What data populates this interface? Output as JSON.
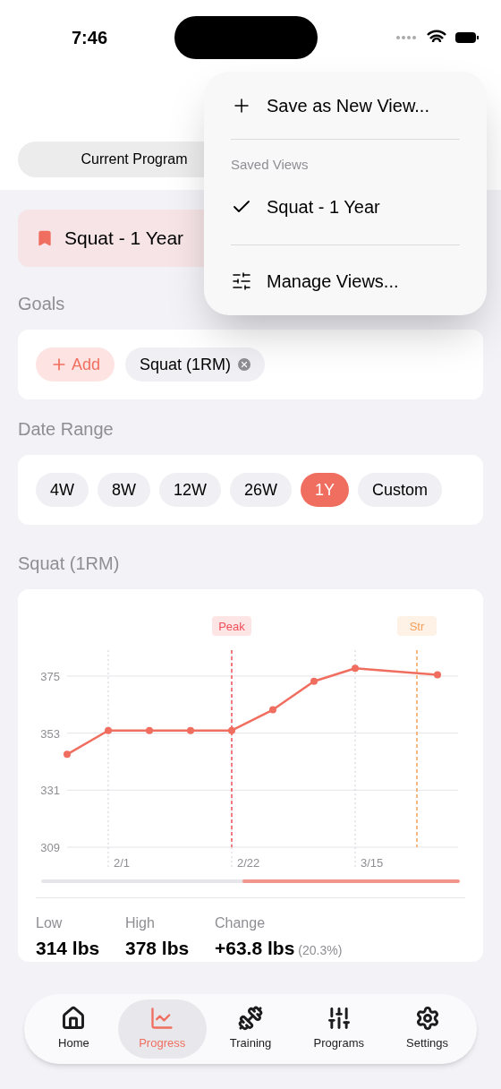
{
  "status_bar": {
    "time": "7:46"
  },
  "segmented": {
    "label": "Current Program"
  },
  "saved_view": {
    "title": "Squat - 1 Year"
  },
  "menu": {
    "items": [
      {
        "kind": "add",
        "label": "Save as New View..."
      },
      {
        "kind": "header",
        "label": "Saved Views"
      },
      {
        "kind": "view",
        "label": "Squat - 1 Year",
        "selected": true
      },
      {
        "kind": "manage",
        "label": "Manage Views..."
      }
    ]
  },
  "goals": {
    "title": "Goals",
    "add_label": "Add",
    "chips": [
      "Squat (1RM)"
    ]
  },
  "date_range": {
    "title": "Date Range",
    "options": [
      {
        "label": "4W",
        "selected": false
      },
      {
        "label": "8W",
        "selected": false
      },
      {
        "label": "12W",
        "selected": false
      },
      {
        "label": "26W",
        "selected": false
      },
      {
        "label": "1Y",
        "selected": true
      },
      {
        "label": "Custom",
        "selected": false
      }
    ]
  },
  "chart_section": {
    "title": "Squat (1RM)",
    "markers": [
      {
        "label": "Peak",
        "color": "#f0505a"
      },
      {
        "label": "Str",
        "color": "#f5a05a"
      }
    ],
    "chart_data": {
      "type": "line",
      "categories": [
        null,
        "2/1",
        null,
        null,
        "2/22",
        null,
        null,
        "3/15",
        null,
        null
      ],
      "series": [
        {
          "color": "#f06e5f",
          "marker": true,
          "values": [
            344.8,
            354,
            354,
            354,
            354,
            362,
            373,
            378,
            null,
            375.5
          ]
        }
      ],
      "grid": true,
      "ylim": [
        309,
        385
      ],
      "yticks": [
        309,
        331,
        353,
        375
      ]
    },
    "stats": [
      {
        "label": "Low",
        "value": "314 lbs"
      },
      {
        "label": "High",
        "value": "378 lbs"
      },
      {
        "label": "Change",
        "value": "+63.8 lbs",
        "note": "(20.3%)"
      }
    ]
  },
  "tab_bar": [
    {
      "label": "Home",
      "selected": false
    },
    {
      "label": "Progress",
      "selected": true
    },
    {
      "label": "Training",
      "selected": false
    },
    {
      "label": "Programs",
      "selected": false
    },
    {
      "label": "Settings",
      "selected": false
    }
  ]
}
